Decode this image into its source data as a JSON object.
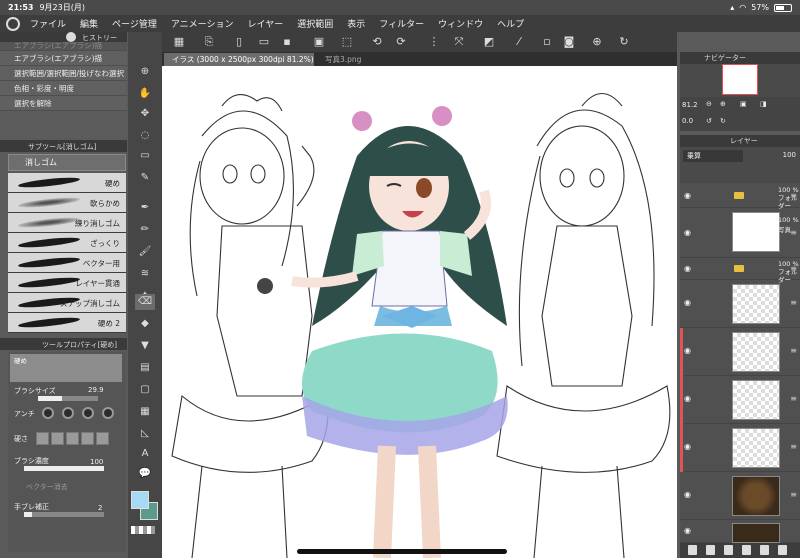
{
  "status": {
    "time": "21:53",
    "date": "9月23日(月)",
    "battery": "57%",
    "battery_level": 0.57,
    "wifi_icon": "wifi-icon",
    "signal_icon": "signal-icon"
  },
  "menu": {
    "items": [
      "ファイル",
      "編集",
      "ページ管理",
      "アニメーション",
      "レイヤー",
      "選択範囲",
      "表示",
      "フィルター",
      "ウィンドウ",
      "ヘルプ"
    ]
  },
  "left": {
    "history_tab": "ヒストリー",
    "history_items": [
      "エアブラシ(エアブラシ)描",
      "エアブラシ(エアブラシ)描",
      "選択範囲/選択範囲/投げなわ選択",
      "色相・彩度・明度",
      "選択を解除"
    ],
    "subtool_tab": "サブツール[消しゴム]",
    "subtool_group": "消しゴム",
    "brushes": [
      "硬め",
      "軟らかめ",
      "練り消しゴム",
      "ざっくり",
      "ベクター用",
      "レイヤー貫通",
      "スナップ消しゴム",
      "硬め 2"
    ],
    "prop_tab": "ツールプロパティ[硬め]",
    "prop_preview": "硬め",
    "brush_size_label": "ブラシサイズ",
    "brush_size": "29.9",
    "antialias_label": "アンチ",
    "hardness_label": "硬さ",
    "density_label": "ブラシ濃度",
    "density": "100",
    "vector_label": "ベクター消去",
    "stabilize_label": "手ブレ補正",
    "stabilize": "2"
  },
  "tools": {
    "main_color": "#a9d8f2",
    "sub_color": "#5c9a8e"
  },
  "canvas": {
    "tab1": "イラス (3000 x 2500px 300dpi 81.2%)",
    "tab2": "写真3.png"
  },
  "right": {
    "navigator_tab": "ナビゲーター",
    "zoom": "81.2",
    "rotation": "0.0",
    "layer_tab": "レイヤー",
    "blend": "乗算",
    "opacity": "100",
    "layers": [
      {
        "type": "folder",
        "opacity": "100 %",
        "name": "フォルダー"
      },
      {
        "type": "image",
        "opacity": "100 %",
        "name": "写真"
      },
      {
        "type": "folder",
        "opacity": "100 %",
        "name": "フォルダー"
      }
    ]
  }
}
